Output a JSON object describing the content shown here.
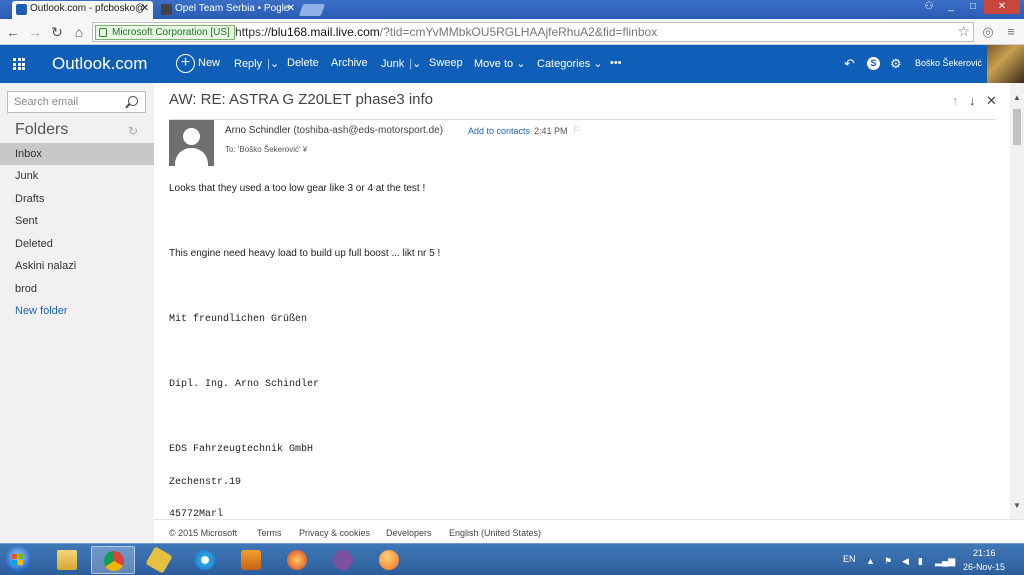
{
  "browser": {
    "tabs": [
      {
        "title": "Outlook.com - pfcbosko@",
        "active": true
      },
      {
        "title": "Opel Team Serbia • Pogle",
        "active": false
      }
    ],
    "address": {
      "ev_label": "Microsoft Corporation [US]",
      "url_scheme": "https://",
      "url_host": "blu168.mail.live.com",
      "url_rest": "/?tid=cmYvMMbkOU5RGLHAAjfeRhuA2&fid=flinbox"
    },
    "window_buttons": [
      "_",
      "□",
      "✕"
    ]
  },
  "outlook": {
    "brand": "Outlook.com",
    "commands": {
      "new": "New",
      "reply": "Reply",
      "delete": "Delete",
      "archive": "Archive",
      "junk": "Junk",
      "sweep": "Sweep",
      "move_to": "Move to",
      "categories": "Categories",
      "more": "•••"
    },
    "user_name": "Boško Šekerović"
  },
  "sidebar": {
    "search_placeholder": "Search email",
    "folders_title": "Folders",
    "folders": [
      "Inbox",
      "Junk",
      "Drafts",
      "Sent",
      "Deleted",
      "Askini nalazi",
      "brod"
    ],
    "new_folder": "New folder",
    "selected": "Inbox"
  },
  "message": {
    "subject": "AW: RE: ASTRA G Z20LET phase3 info",
    "sender_name": "Arno Schindler",
    "sender_email": "(toshiba-ash@eds-motorsport.de)",
    "add_to_contacts": "Add to contacts",
    "time": "2:41 PM",
    "to": "To: 'Boško Šekerović' ¥",
    "body": [
      "Looks that they used a too low gear like 3 or 4 at the test !",
      "This engine need heavy load to build up full boost ... likt nr 5 !",
      "Mit freundlichen Grüßen",
      "Dipl. Ing. Arno Schindler",
      "EDS Fahrzeugtechnik GmbH",
      "Zechenstr.19",
      "45772Marl"
    ]
  },
  "footer": {
    "copyright": "© 2015 Microsoft",
    "terms": "Terms",
    "privacy": "Privacy & cookies",
    "developers": "Developers",
    "language": "English (United States)"
  },
  "taskbar": {
    "lang": "EN",
    "time": "21:16",
    "date": "26-Nov-15"
  },
  "colors": {
    "outlook_blue": "#0f5eb8",
    "link_blue": "#1c62b9",
    "sidebar_bg": "#f1f1f1",
    "selected_folder": "#c8c8c8"
  }
}
